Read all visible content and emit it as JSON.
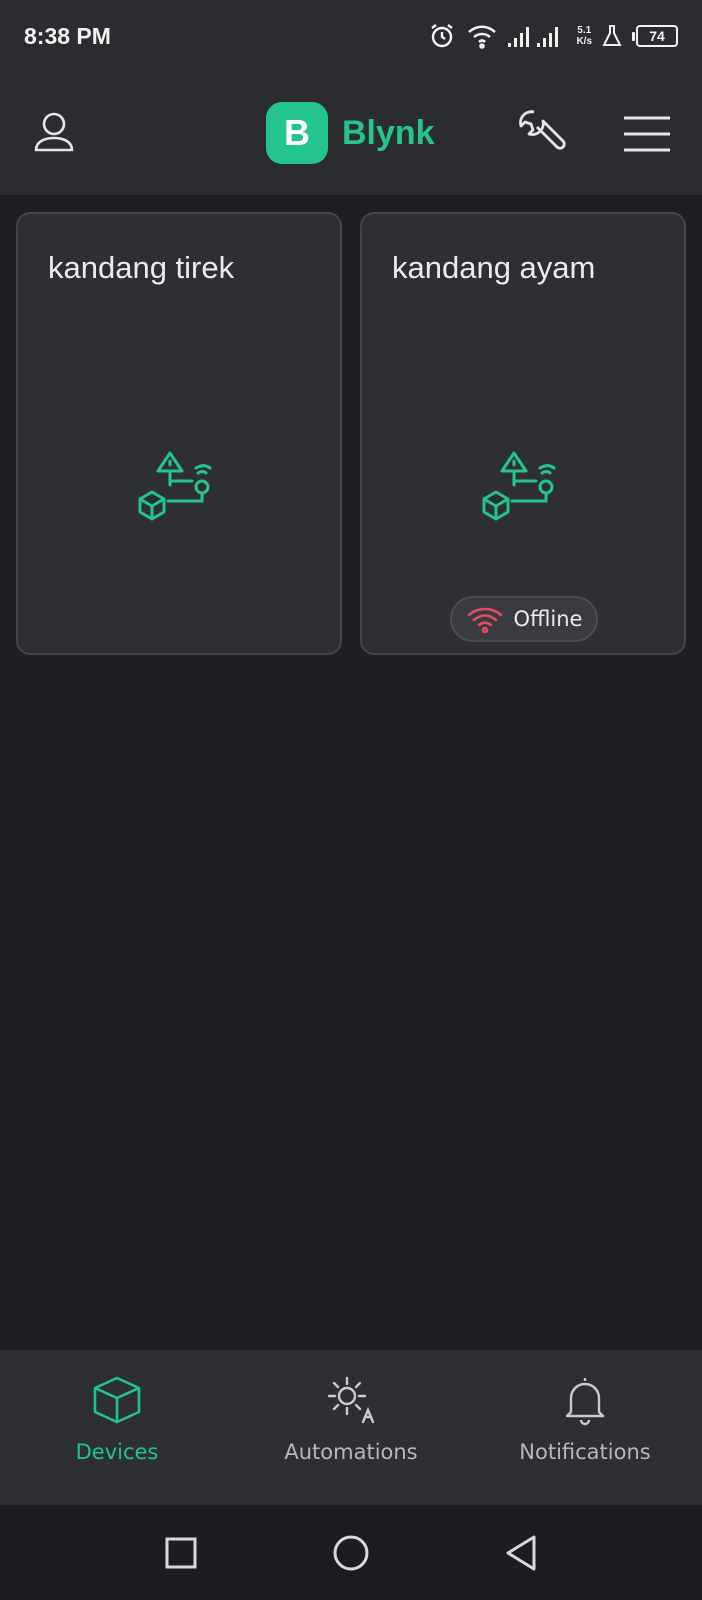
{
  "status": {
    "time": "8:38 PM",
    "speed_value": "5.1",
    "speed_unit": "K/s",
    "battery": "74"
  },
  "appbar": {
    "logo_letter": "B",
    "logo_text": "Blynk"
  },
  "devices": [
    {
      "name": "kandang tirek",
      "status": ""
    },
    {
      "name": "kandang ayam",
      "status": "Offline"
    }
  ],
  "tabs": [
    {
      "label": "Devices",
      "icon": "cube-icon",
      "active": true
    },
    {
      "label": "Automations",
      "icon": "sun-a-icon",
      "active": false
    },
    {
      "label": "Notifications",
      "icon": "bell-icon",
      "active": false
    }
  ],
  "colors": {
    "brand": "#23c48e",
    "offline": "#e24d63",
    "background": "#1e1f22",
    "card": "#2e2f33"
  }
}
